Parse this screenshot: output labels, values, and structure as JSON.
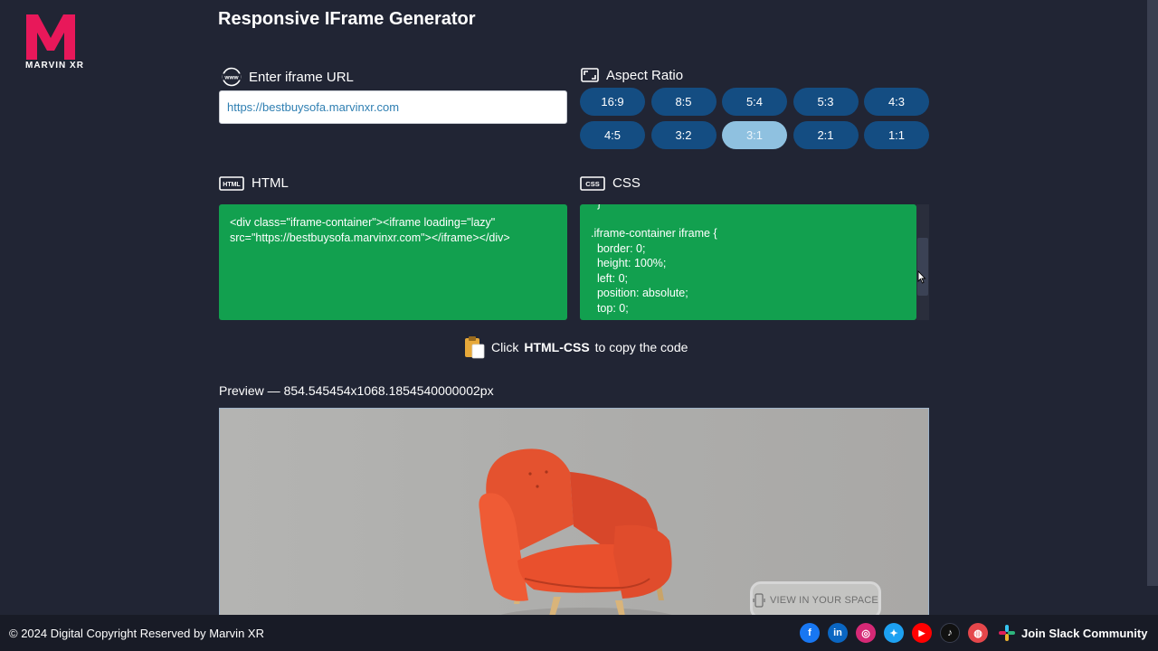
{
  "logo": {
    "brand": "MARVIN XR",
    "color": "#e8185a"
  },
  "page_title": "Responsive IFrame Generator",
  "url_section": {
    "label": "Enter iframe URL",
    "value": "https://bestbuysofa.marvinxr.com"
  },
  "aspect_section": {
    "label": "Aspect Ratio",
    "ratios": [
      "16:9",
      "8:5",
      "5:4",
      "5:3",
      "4:3",
      "4:5",
      "3:2",
      "3:1",
      "2:1",
      "1:1"
    ],
    "selected": "3:1"
  },
  "html_section": {
    "label": "HTML",
    "code_line1": "<div class=\"iframe-container\"><iframe loading=\"lazy\"",
    "code_line2": "src=\"https://bestbuysofa.marvinxr.com\"></iframe></div>"
  },
  "css_section": {
    "label": "CSS",
    "code": "  }\n\n.iframe-container iframe {\n  border: 0;\n  height: 100%;\n  left: 0;\n  position: absolute;\n  top: 0;"
  },
  "copy_hint": {
    "prefix": "Click",
    "bold": "HTML-CSS",
    "suffix": "to copy the code"
  },
  "preview": {
    "label": "Preview — 854.545454x1068.1854540000002px",
    "view_button": "VIEW IN YOUR SPACE"
  },
  "footer": {
    "copyright": "© 2024 Digital Copyright Reserved by Marvin XR",
    "socials": [
      {
        "icon": "facebook-icon",
        "glyph": "f",
        "color": "#1877f2"
      },
      {
        "icon": "linkedin-icon",
        "glyph": "in",
        "color": "#0a66c2"
      },
      {
        "icon": "instagram-icon",
        "glyph": "◎",
        "color": "#d62976"
      },
      {
        "icon": "twitter-icon",
        "glyph": "✦",
        "color": "#1da1f2"
      },
      {
        "icon": "youtube-icon",
        "glyph": "▶",
        "color": "#ff0000"
      },
      {
        "icon": "tiktok-icon",
        "glyph": "♪",
        "color": "#111111"
      },
      {
        "icon": "globe-icon",
        "glyph": "◍",
        "color": "#e5474b"
      }
    ],
    "slack_label": "Join Slack Community"
  },
  "colors": {
    "background": "#212534",
    "button": "#144d82",
    "button_active": "#8fc1e0",
    "code_bg": "#12a04f"
  }
}
